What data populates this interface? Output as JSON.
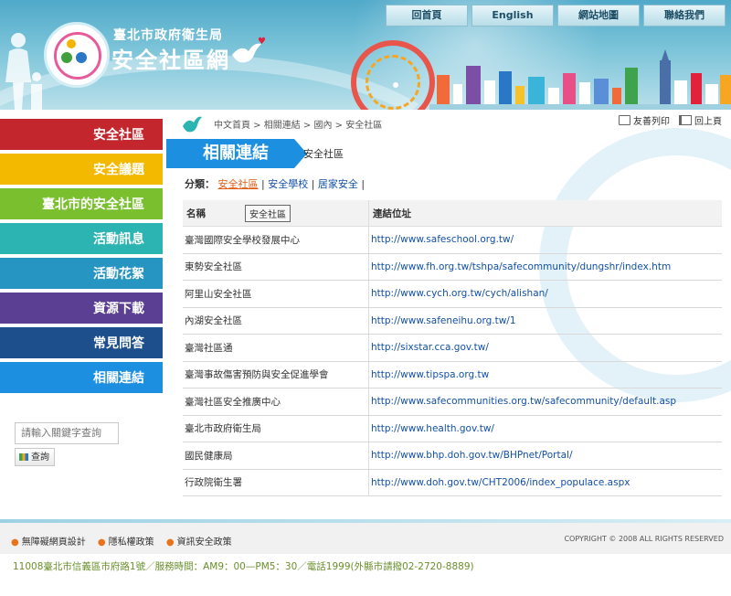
{
  "header": {
    "org_name": "臺北市政府衛生局",
    "site_name": "安全社區網",
    "nav": [
      "回首頁",
      "English",
      "網站地圖",
      "聯絡我們"
    ]
  },
  "left_menu": {
    "items": [
      {
        "label": "安全社區",
        "color": "#c4262e"
      },
      {
        "label": "安全議題",
        "color": "#f3b900"
      },
      {
        "label": "臺北市的安全社區",
        "color": "#7abf2e"
      },
      {
        "label": "活動訊息",
        "color": "#2bb4b1"
      },
      {
        "label": "活動花絮",
        "color": "#2795c2"
      },
      {
        "label": "資源下載",
        "color": "#5a3f93"
      },
      {
        "label": "常見問答",
        "color": "#1d4f8c"
      },
      {
        "label": "相關連結",
        "color": "#1c8fe0"
      }
    ],
    "search_placeholder": "請輸入關鍵字查詢",
    "search_button": "查詢"
  },
  "content": {
    "breadcrumb": "中文首頁 > 相關連結 > 國內 > 安全社區",
    "print_label": "友善列印",
    "back_label": "回上頁",
    "title": "相關連結",
    "subtitle": "安全社區",
    "category_label": "分類：",
    "categories": [
      "安全社區",
      "安全學校",
      "居家安全"
    ],
    "table_headers": [
      "名稱",
      "連結位址"
    ],
    "tooltip": "安全社區",
    "rows": [
      {
        "name": "臺灣國際安全學校發展中心",
        "url": "http://www.safeschool.org.tw/"
      },
      {
        "name": "東勢安全社區",
        "url": "http://www.fh.org.tw/tshpa/safecommunity/dungshr/index.htm"
      },
      {
        "name": "阿里山安全社區",
        "url": "http://www.cych.org.tw/cych/alishan/"
      },
      {
        "name": "內湖安全社區",
        "url": "http://www.safeneihu.org.tw/1"
      },
      {
        "name": "臺灣社區通",
        "url": "http://sixstar.cca.gov.tw/"
      },
      {
        "name": "臺灣事故傷害預防與安全促進學會",
        "url": "http://www.tipspa.org.tw"
      },
      {
        "name": "臺灣社區安全推廣中心",
        "url": "http://www.safecommunities.org.tw/safecommunity/default.asp"
      },
      {
        "name": "臺北市政府衛生局",
        "url": "http://www.health.gov.tw/"
      },
      {
        "name": "國民健康局",
        "url": "http://www.bhp.doh.gov.tw/BHPnet/Portal/"
      },
      {
        "name": "行政院衛生署",
        "url": "http://www.doh.gov.tw/CHT2006/index_populace.aspx"
      }
    ]
  },
  "footer": {
    "links": [
      "無障礙網頁設計",
      "隱私權政策",
      "資訊安全政策"
    ],
    "copyright": "COPYRIGHT © 2008 ALL RIGHTS RESERVED",
    "address": "11008臺北市信義區市府路1號／服務時間：AM9：00—PM5：30／電話1999(外縣市請撥02-2720-8889)"
  }
}
